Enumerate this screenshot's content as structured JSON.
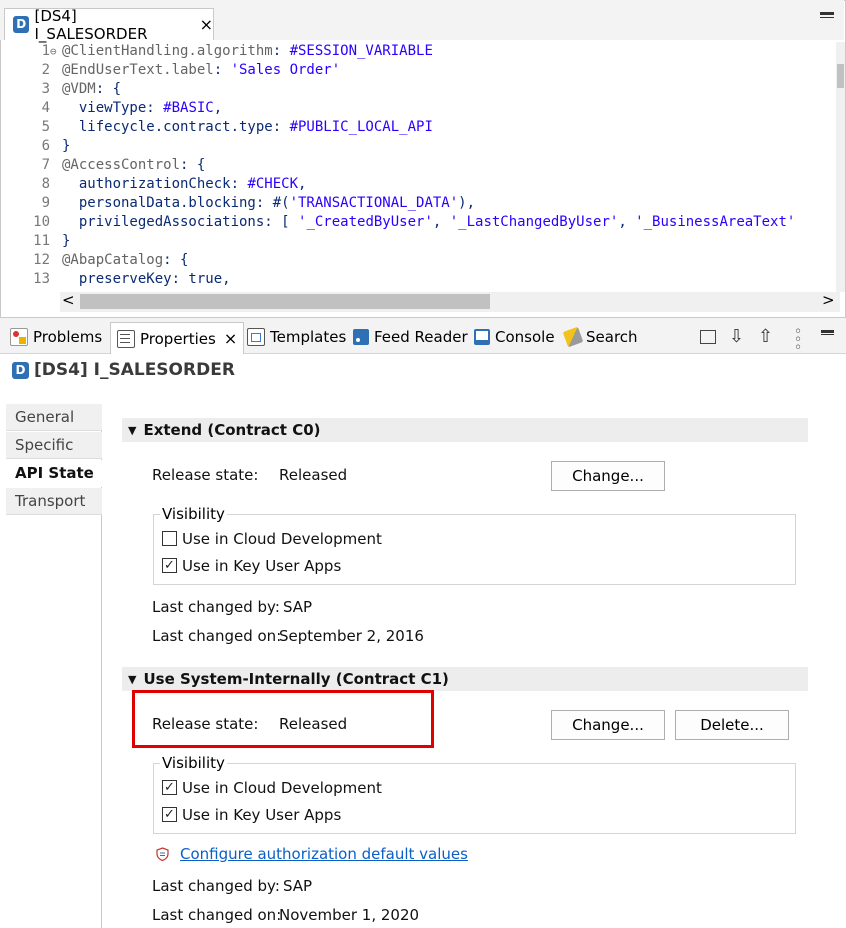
{
  "editor": {
    "tab_icon": "D",
    "tab_title": "[DS4] I_SALESORDER",
    "close_glyph": "×",
    "lines": [
      {
        "n": "1",
        "fold": "⊖",
        "text": "@ClientHandling.algorithm: #SESSION_VARIABLE"
      },
      {
        "n": "2",
        "fold": "",
        "text": "@EndUserText.label: 'Sales Order'"
      },
      {
        "n": "3",
        "fold": "",
        "text": "@VDM: {"
      },
      {
        "n": "4",
        "fold": "",
        "text": "  viewType: #BASIC,"
      },
      {
        "n": "5",
        "fold": "",
        "text": "  lifecycle.contract.type: #PUBLIC_LOCAL_API"
      },
      {
        "n": "6",
        "fold": "",
        "text": "}"
      },
      {
        "n": "7",
        "fold": "",
        "text": "@AccessControl: {"
      },
      {
        "n": "8",
        "fold": "",
        "text": "  authorizationCheck: #CHECK,"
      },
      {
        "n": "9",
        "fold": "",
        "text": "  personalData.blocking: #('TRANSACTIONAL_DATA'),"
      },
      {
        "n": "10",
        "fold": "",
        "text": "  privilegedAssociations: [ '_CreatedByUser', '_LastChangedByUser', '_BusinessAreaText'"
      },
      {
        "n": "11",
        "fold": "",
        "text": "}"
      },
      {
        "n": "12",
        "fold": "",
        "text": "@AbapCatalog: {"
      },
      {
        "n": "13",
        "fold": "",
        "text": "  preserveKey: true,"
      }
    ],
    "scroll_left": "<",
    "scroll_right": ">"
  },
  "views": {
    "tabs": {
      "problems": "Problems",
      "properties": "Properties",
      "templates": "Templates",
      "feed_reader": "Feed Reader",
      "console": "Console",
      "search": "Search"
    },
    "close_glyph": "×"
  },
  "properties": {
    "icon": "D",
    "title": "[DS4] I_SALESORDER",
    "nav": [
      "General",
      "Specific",
      "API State",
      "Transport"
    ],
    "extend": {
      "header": "Extend (Contract C0)",
      "release_label": "Release state:",
      "release_value": "Released",
      "change_button": "Change...",
      "visibility_title": "Visibility",
      "cloud_label": "Use in Cloud Development",
      "cloud_checked": false,
      "keyuser_label": "Use in Key User Apps",
      "keyuser_checked": true,
      "changed_by_label": "Last changed by:",
      "changed_by_value": "SAP",
      "changed_on_label": "Last changed on:",
      "changed_on_value": "September 2, 2016"
    },
    "internal": {
      "header": "Use System-Internally (Contract C1)",
      "release_label": "Release state:",
      "release_value": "Released",
      "change_button": "Change...",
      "delete_button": "Delete...",
      "visibility_title": "Visibility",
      "cloud_label": "Use in Cloud Development",
      "cloud_checked": true,
      "keyuser_label": "Use in Key User Apps",
      "keyuser_checked": true,
      "link": "Configure authorization default values",
      "changed_by_label": "Last changed by:",
      "changed_by_value": "SAP",
      "changed_on_label": "Last changed on:",
      "changed_on_value": "November 1, 2020"
    }
  },
  "colors": {
    "accent_blue": "#2f6fb3",
    "link_blue": "#0b5fc6",
    "highlight_red": "#e00000"
  },
  "glyphs": {
    "check": "✓",
    "triangle_down": "▼"
  }
}
